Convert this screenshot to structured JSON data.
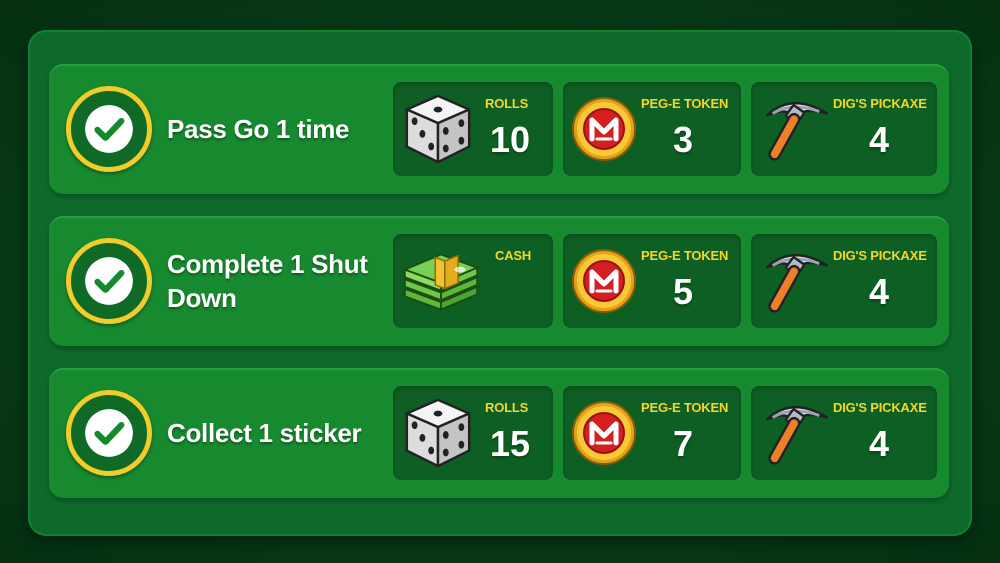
{
  "missions": [
    {
      "task": "Pass Go 1 time",
      "rewards": [
        {
          "icon": "dice-icon",
          "label": "ROLLS",
          "value": "10"
        },
        {
          "icon": "peg-e-token-icon",
          "label": "PEG-E TOKEN",
          "value": "3"
        },
        {
          "icon": "pickaxe-icon",
          "label": "DIG'S PICKAXE",
          "value": "4"
        }
      ]
    },
    {
      "task": "Complete 1 Shut Down",
      "rewards": [
        {
          "icon": "cash-stack-icon",
          "label": "CASH",
          "value": ""
        },
        {
          "icon": "peg-e-token-icon",
          "label": "PEG-E TOKEN",
          "value": "5"
        },
        {
          "icon": "pickaxe-icon",
          "label": "DIG'S PICKAXE",
          "value": "4"
        }
      ]
    },
    {
      "task": "Collect 1 sticker",
      "rewards": [
        {
          "icon": "dice-icon",
          "label": "ROLLS",
          "value": "15"
        },
        {
          "icon": "peg-e-token-icon",
          "label": "PEG-E TOKEN",
          "value": "7"
        },
        {
          "icon": "pickaxe-icon",
          "label": "DIG'S PICKAXE",
          "value": "4"
        }
      ]
    }
  ],
  "colors": {
    "label_yellow": "#f6d626",
    "check_ring": "#f2cc2a",
    "row_green": "#17892f",
    "reward_green": "#0d5f23"
  }
}
